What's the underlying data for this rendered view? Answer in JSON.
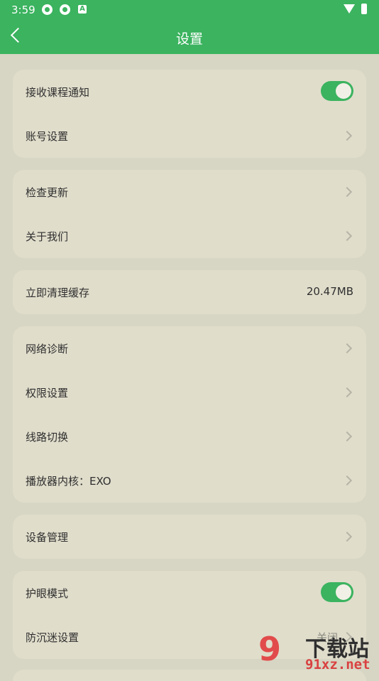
{
  "status_bar": {
    "time": "3:59",
    "icons": [
      "notification-icon",
      "notification-icon",
      "a-icon",
      "wifi-icon",
      "battery-icon"
    ]
  },
  "app_bar": {
    "title": "设置",
    "back_icon": "back-arrow-icon"
  },
  "colors": {
    "accent": "#3bb35f",
    "background": "#d7d5c3",
    "card": "#e0ddcb"
  },
  "sections": [
    {
      "rows": [
        {
          "label": "接收课程通知",
          "type": "toggle",
          "on": true
        },
        {
          "label": "账号设置",
          "type": "nav"
        }
      ]
    },
    {
      "rows": [
        {
          "label": "检查更新",
          "type": "nav"
        },
        {
          "label": "关于我们",
          "type": "nav"
        }
      ]
    },
    {
      "rows": [
        {
          "label": "立即清理缓存",
          "type": "value",
          "value": "20.47MB"
        }
      ]
    },
    {
      "rows": [
        {
          "label": "网络诊断",
          "type": "nav"
        },
        {
          "label": "权限设置",
          "type": "nav"
        },
        {
          "label": "线路切换",
          "type": "nav"
        },
        {
          "label": "播放器内核：EXO",
          "type": "nav"
        }
      ]
    },
    {
      "rows": [
        {
          "label": "设备管理",
          "type": "nav"
        }
      ]
    },
    {
      "rows": [
        {
          "label": "护眼模式",
          "type": "toggle",
          "on": true
        },
        {
          "label": "防沉迷设置",
          "type": "value",
          "value": "关闭"
        }
      ]
    }
  ],
  "watermark": {
    "logo": "9",
    "name": "下载站",
    "url": "91xz.net"
  }
}
